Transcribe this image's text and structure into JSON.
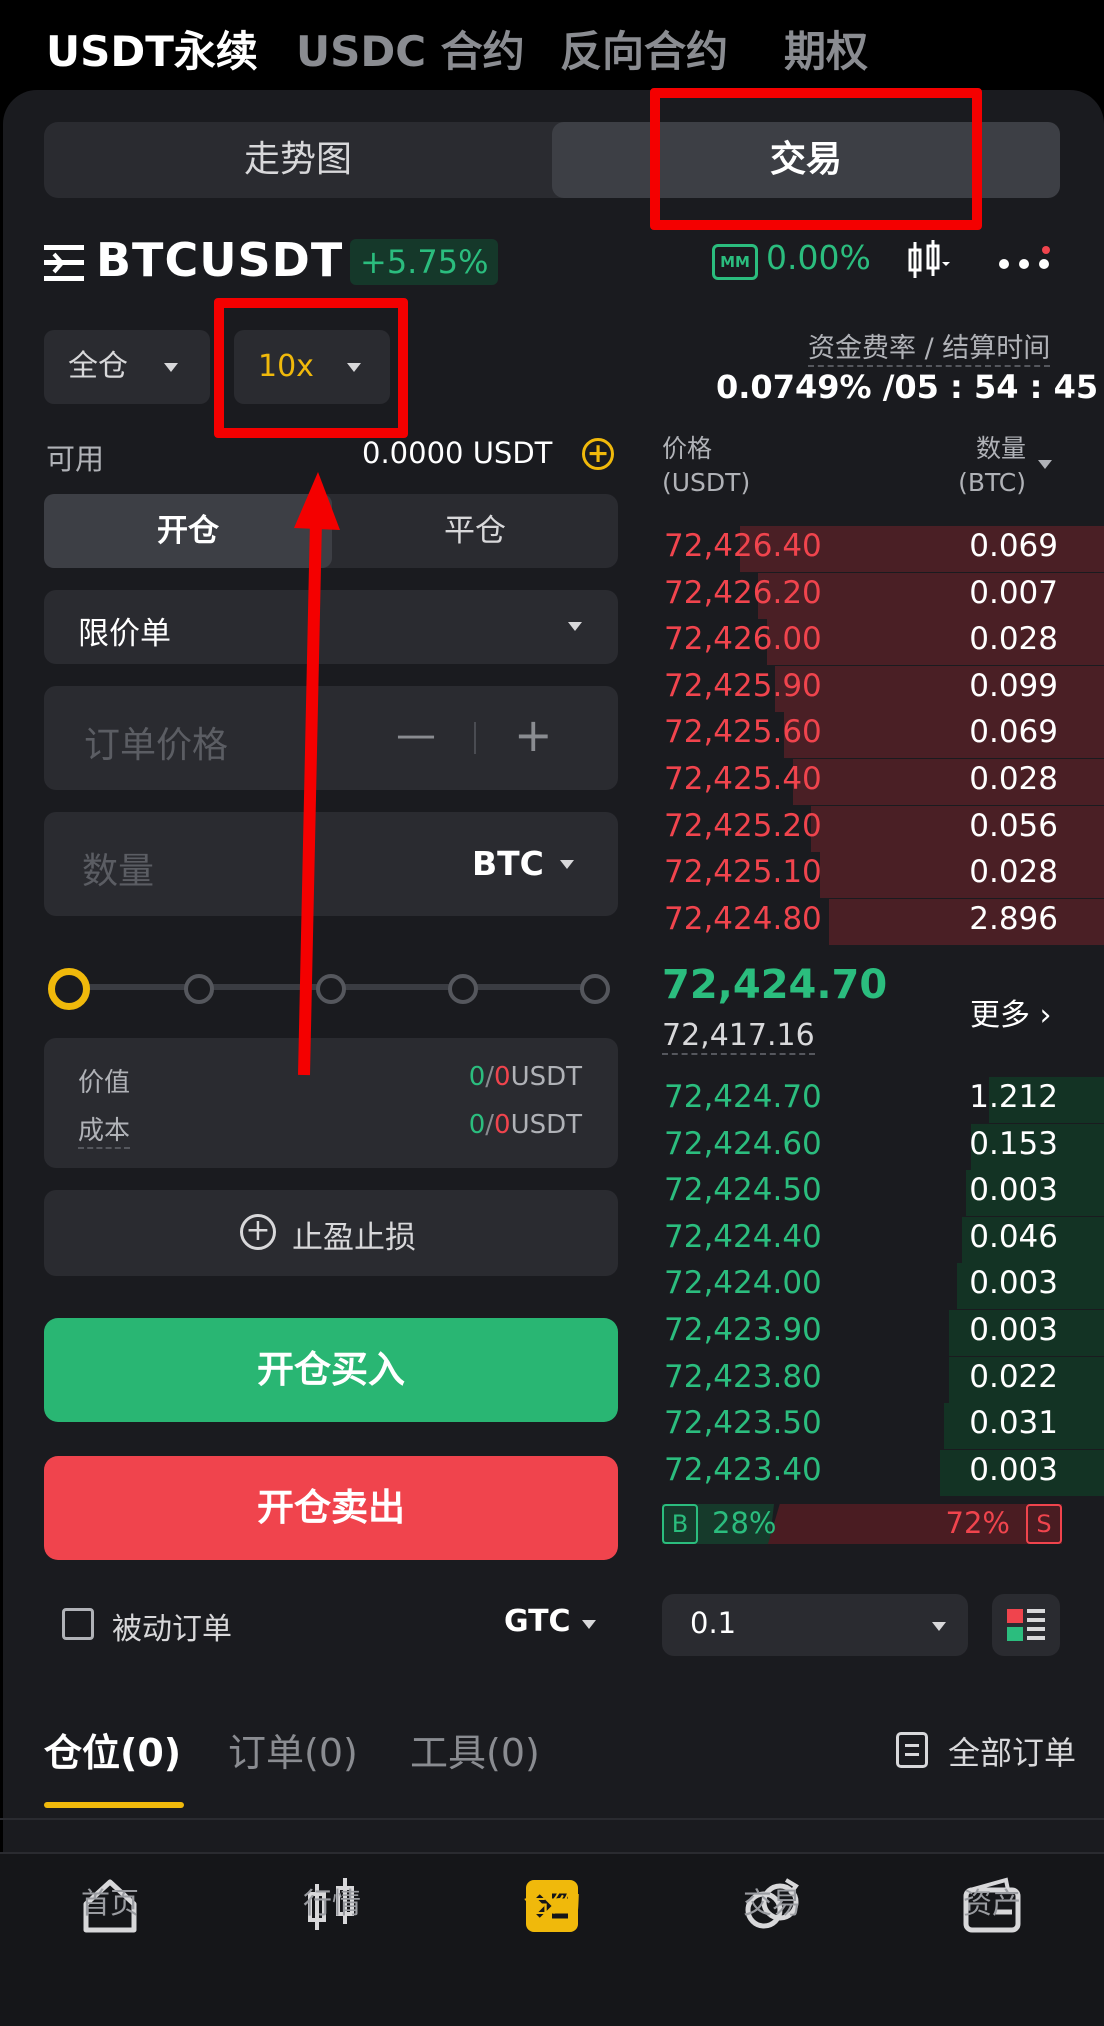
{
  "top_tabs": [
    "USDT永续",
    "USDC 合约",
    "反向合约",
    "期权"
  ],
  "segment": {
    "left": "走势图",
    "right": "交易"
  },
  "pair": {
    "symbol": "BTCUSDT",
    "change": "+5.75%",
    "mm_label": "MM",
    "mm_value": "0.00%"
  },
  "margin": {
    "mode": "全仓",
    "leverage": "10x"
  },
  "funding": {
    "label": "资金费率 / 结算时间",
    "value": "0.0749% /05 : 54 : 45"
  },
  "available": {
    "label": "可用",
    "value": "0.0000 USDT"
  },
  "open_close": {
    "open": "开仓",
    "close": "平仓"
  },
  "order_type": "限价单",
  "price_input": {
    "placeholder": "订单价格",
    "minus": "—",
    "plus": "+"
  },
  "qty_input": {
    "placeholder": "数量",
    "unit": "BTC"
  },
  "slider_level": 0,
  "summary": {
    "value_label": "价值",
    "value_a": "0",
    "value_sep": "/",
    "value_b": "0",
    "value_unit": "USDT",
    "cost_label": "成本",
    "cost_a": "0",
    "cost_sep": "/",
    "cost_b": "0",
    "cost_unit": "USDT"
  },
  "tp_sl": "止盈止损",
  "buy_button": "开仓买入",
  "sell_button": "开仓卖出",
  "post_only": "被动订单",
  "tif": "GTC",
  "orderbook": {
    "price_header": "价格",
    "price_unit": "(USDT)",
    "qty_header": "数量",
    "qty_unit": "(BTC)",
    "asks": [
      {
        "price": "72,426.40",
        "qty": "0.069"
      },
      {
        "price": "72,426.20",
        "qty": "0.007"
      },
      {
        "price": "72,426.00",
        "qty": "0.028"
      },
      {
        "price": "72,425.90",
        "qty": "0.099"
      },
      {
        "price": "72,425.60",
        "qty": "0.069"
      },
      {
        "price": "72,425.40",
        "qty": "0.028"
      },
      {
        "price": "72,425.20",
        "qty": "0.056"
      },
      {
        "price": "72,425.10",
        "qty": "0.028"
      },
      {
        "price": "72,424.80",
        "qty": "2.896"
      }
    ],
    "last_price": "72,424.70",
    "mark_price": "72,417.16",
    "more": "更多 ›",
    "bids": [
      {
        "price": "72,424.70",
        "qty": "1.212"
      },
      {
        "price": "72,424.60",
        "qty": "0.153"
      },
      {
        "price": "72,424.50",
        "qty": "0.003"
      },
      {
        "price": "72,424.40",
        "qty": "0.046"
      },
      {
        "price": "72,424.00",
        "qty": "0.003"
      },
      {
        "price": "72,423.90",
        "qty": "0.003"
      },
      {
        "price": "72,423.80",
        "qty": "0.022"
      },
      {
        "price": "72,423.50",
        "qty": "0.031"
      },
      {
        "price": "72,423.40",
        "qty": "0.003"
      }
    ],
    "buy_ratio": "28%",
    "sell_ratio": "72%",
    "buy_tag": "B",
    "sell_tag": "S",
    "precision": "0.1"
  },
  "bottom_tabs": {
    "positions": "仓位(0)",
    "orders": "订单(0)",
    "tools": "工具(0)",
    "all_orders": "全部订单"
  },
  "nav": [
    "首页",
    "行情",
    "合约",
    "交易",
    "资产"
  ],
  "colors": {
    "green": "#2bbd7e",
    "red": "#f0444d",
    "accent": "#f0b90b",
    "panel": "#1a1b1f"
  }
}
